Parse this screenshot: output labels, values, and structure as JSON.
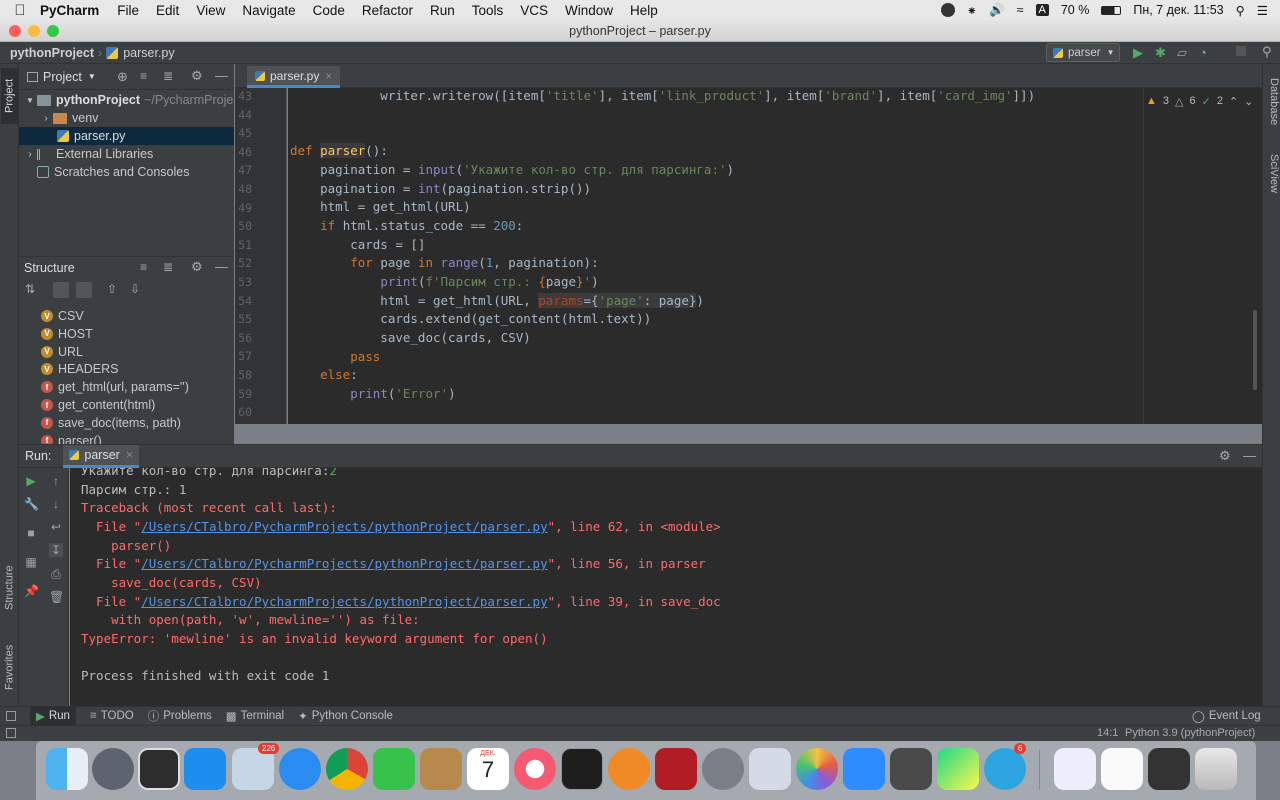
{
  "menubar": {
    "app": "PyCharm",
    "items": [
      "File",
      "Edit",
      "View",
      "Navigate",
      "Code",
      "Refactor",
      "Run",
      "Tools",
      "VCS",
      "Window",
      "Help"
    ],
    "battery": "70 %",
    "datetime": "Пн, 7 дек.  11:53",
    "keyboard": "A"
  },
  "window": {
    "title": "pythonProject – parser.py"
  },
  "navbar": {
    "project": "pythonProject",
    "file": "parser.py",
    "run_config": "parser"
  },
  "side_tabs": {
    "project": "Project",
    "structure": "Structure",
    "favorites": "Favorites",
    "database": "Database",
    "sciview": "SciView"
  },
  "project_panel": {
    "title": "Project",
    "root": "pythonProject",
    "root_path": "~/PycharmProje",
    "items": [
      "venv",
      "parser.py",
      "External Libraries",
      "Scratches and Consoles"
    ]
  },
  "structure_panel": {
    "title": "Structure",
    "items": [
      {
        "kind": "V",
        "label": "CSV"
      },
      {
        "kind": "V",
        "label": "HOST"
      },
      {
        "kind": "V",
        "label": "URL"
      },
      {
        "kind": "V",
        "label": "HEADERS"
      },
      {
        "kind": "f",
        "label": "get_html(url, params='')"
      },
      {
        "kind": "f",
        "label": "get_content(html)"
      },
      {
        "kind": "f",
        "label": "save_doc(items, path)"
      },
      {
        "kind": "f",
        "label": "parser()"
      }
    ]
  },
  "editor": {
    "tab": "parser.py",
    "inspections": {
      "warnings": "3",
      "weak": "6",
      "ok": "2"
    },
    "line_numbers": [
      "43",
      "44",
      "45",
      "46",
      "47",
      "48",
      "49",
      "50",
      "51",
      "52",
      "53",
      "54",
      "55",
      "56",
      "57",
      "58",
      "59",
      "60"
    ]
  },
  "run_panel": {
    "label": "Run:",
    "tab": "parser",
    "console": {
      "l0": "Укажите кол-во стр. для парсинга:",
      "l0_input": "2",
      "l1": "Парсим стр.: 1",
      "l2": "Traceback (most recent call last):",
      "file_prefix": "  File \"",
      "path": "/Users/CTalbro/PycharmProjects/pythonProject/parser.py",
      "l3_tail": "\", line 62, in <module>",
      "l4": "    parser()",
      "l5_tail": "\", line 56, in parser",
      "l6": "    save_doc(cards, CSV)",
      "l7_tail": "\", line 39, in save_doc",
      "l8": "    with open(path, 'w', mewline='') as file:",
      "l9": "TypeError: 'mewline' is an invalid keyword argument for open()",
      "l10": "Process finished with exit code 1"
    }
  },
  "bottom_tabs": {
    "run": "Run",
    "todo": "TODO",
    "problems": "Problems",
    "terminal": "Terminal",
    "python_console": "Python Console",
    "event_log": "Event Log"
  },
  "status": {
    "position": "14:1",
    "interpreter": "Python 3.9 (pythonProject)"
  },
  "dock": {
    "badges": {
      "mail": "226",
      "telegram": "6"
    },
    "calendar_month": "ДЕК.",
    "calendar_day": "7"
  },
  "colors": {
    "accent": "#4a88c7",
    "keyword": "#cc7832",
    "string": "#6a8759",
    "error": "#ff6b68",
    "link": "#5394ec"
  }
}
